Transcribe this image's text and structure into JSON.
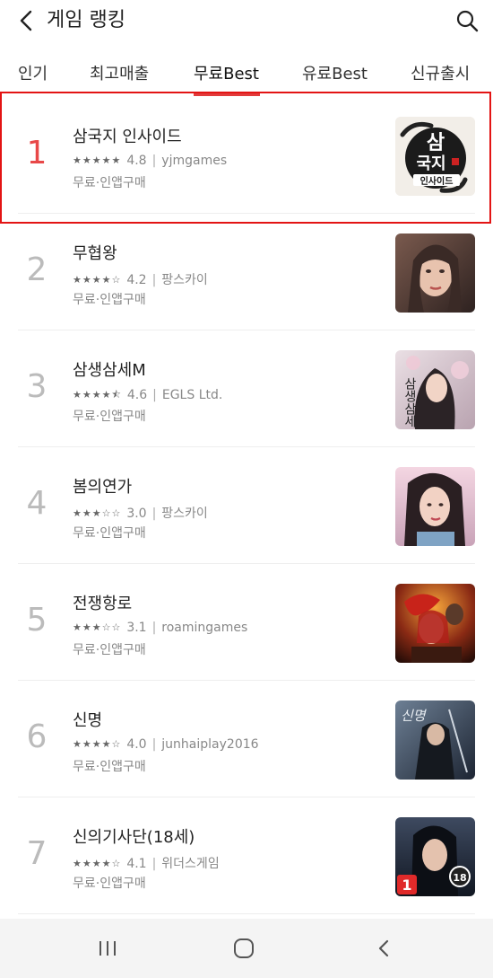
{
  "header": {
    "title": "게임 랭킹",
    "back_icon": "chevron-left-icon",
    "search_icon": "search-icon"
  },
  "tabs": [
    {
      "label": "인기",
      "active": false
    },
    {
      "label": "최고매출",
      "active": false
    },
    {
      "label": "무료Best",
      "active": true
    },
    {
      "label": "유료Best",
      "active": false
    },
    {
      "label": "신규출시",
      "active": false
    }
  ],
  "accent_color": "#e23b3b",
  "highlight_color": "#e31414",
  "games": [
    {
      "rank": "1",
      "name": "삼국지 인사이드",
      "stars": 5,
      "rating": "4.8",
      "publisher": "yjmgames",
      "price": "무료·인앱구매",
      "icon": "samgukji-inside-logo"
    },
    {
      "rank": "2",
      "name": "무협왕",
      "stars": 4,
      "rating": "4.2",
      "publisher": "팡스카이",
      "price": "무료·인앱구매",
      "icon": "woman-portrait"
    },
    {
      "rank": "3",
      "name": "삼생삼세M",
      "stars": 4.5,
      "rating": "4.6",
      "publisher": "EGLS Ltd.",
      "price": "무료·인앱구매",
      "icon": "samsaeng-samse-art"
    },
    {
      "rank": "4",
      "name": "봄의연가",
      "stars": 3,
      "rating": "3.0",
      "publisher": "팡스카이",
      "price": "무료·인앱구매",
      "icon": "woman-portrait"
    },
    {
      "rank": "5",
      "name": "전쟁항로",
      "stars": 3,
      "rating": "3.1",
      "publisher": "roamingames",
      "price": "무료·인앱구매",
      "icon": "warrior-art"
    },
    {
      "rank": "6",
      "name": "신명",
      "stars": 4,
      "rating": "4.0",
      "publisher": "junhaiplay2016",
      "price": "무료·인앱구매",
      "icon": "swordsman-art"
    },
    {
      "rank": "7",
      "name": "신의기사단(18세)",
      "stars": 4,
      "rating": "4.1",
      "publisher": "위더스게임",
      "price": "무료·인앱구매",
      "icon": "dark-heroine-art"
    }
  ],
  "icon_overlays": {
    "game1": {
      "line1": "삼",
      "line2": "국지",
      "line3": "인사이드"
    },
    "game3": {
      "vertical": "삼생삼세"
    },
    "game6": {
      "title": "신명"
    },
    "game7": {
      "badge_left": "1",
      "badge_right": "18"
    }
  },
  "navbar": {
    "recents_icon": "recents-icon",
    "home_icon": "home-icon",
    "back_icon": "back-icon"
  }
}
